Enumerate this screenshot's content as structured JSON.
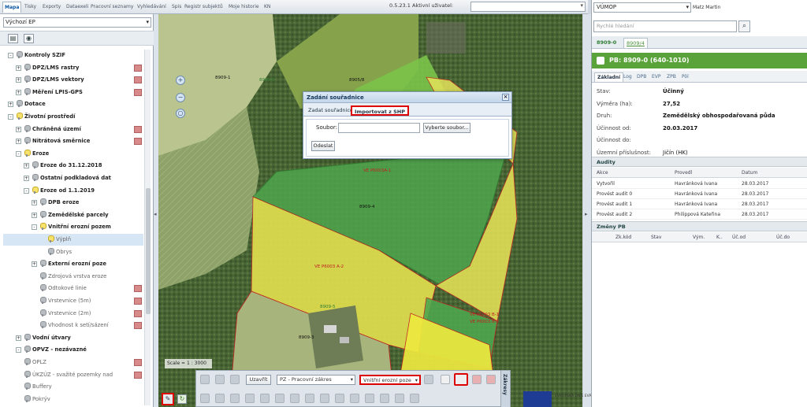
{
  "topbar": {
    "tabs": [
      "Mapa",
      "Tisky",
      "Exporty",
      "Dataexeli",
      "Pracovní seznamy",
      "Vyhledávání",
      "Spis",
      "Registr subjektů",
      "Moje historie",
      "KN"
    ],
    "version": "0.5.23.1",
    "user_label": "Aktivní uživatel:"
  },
  "left": {
    "ep_select": "Výchozí EP",
    "tree": [
      {
        "label": "Kontroly SZIF",
        "bold": true,
        "indent": 0,
        "exp": "-",
        "bulb": false
      },
      {
        "label": "DPZ/LMS rastry",
        "bold": true,
        "indent": 1,
        "exp": "+",
        "bulb": false,
        "legend": true
      },
      {
        "label": "DPZ/LMS vektory",
        "bold": true,
        "indent": 1,
        "exp": "+",
        "bulb": false,
        "legend": true
      },
      {
        "label": "Měření LPIS-GPS",
        "bold": true,
        "indent": 1,
        "exp": "+",
        "bulb": false,
        "legend": true
      },
      {
        "label": "Dotace",
        "bold": true,
        "indent": 0,
        "exp": "+",
        "bulb": false
      },
      {
        "label": "Životní prostředí",
        "bold": true,
        "indent": 0,
        "exp": "-",
        "bulb": true
      },
      {
        "label": "Chráněná území",
        "bold": true,
        "indent": 1,
        "exp": "+",
        "bulb": false,
        "legend": true
      },
      {
        "label": "Nitrátová směrnice",
        "bold": true,
        "indent": 1,
        "exp": "+",
        "bulb": false,
        "legend": true
      },
      {
        "label": "Eroze",
        "bold": true,
        "indent": 1,
        "exp": "-",
        "bulb": true
      },
      {
        "label": "Eroze do 31.12.2018",
        "bold": true,
        "indent": 2,
        "exp": "+",
        "bulb": false
      },
      {
        "label": "Ostatní podkladová dat",
        "bold": true,
        "indent": 2,
        "exp": "+",
        "bulb": false
      },
      {
        "label": "Eroze od 1.1.2019",
        "bold": true,
        "indent": 2,
        "exp": "-",
        "bulb": true
      },
      {
        "label": "DPB eroze",
        "bold": true,
        "indent": 3,
        "exp": "+",
        "bulb": false
      },
      {
        "label": "Zemědělské parcely",
        "bold": true,
        "indent": 3,
        "exp": "+",
        "bulb": false
      },
      {
        "label": "Vnitřní erozní pozem",
        "bold": true,
        "indent": 3,
        "exp": "-",
        "bulb": true
      },
      {
        "label": "Výplň",
        "bold": false,
        "indent": 4,
        "exp": "",
        "bulb": true,
        "selected": true
      },
      {
        "label": "Obrys",
        "bold": false,
        "indent": 4,
        "exp": "",
        "bulb": false
      },
      {
        "label": "Externí erozní poze",
        "bold": true,
        "indent": 3,
        "exp": "+",
        "bulb": false
      },
      {
        "label": "Zdrojová vrstva eroze",
        "bold": false,
        "indent": 3,
        "exp": "",
        "bulb": false
      },
      {
        "label": "Odtokové linie",
        "bold": false,
        "indent": 3,
        "exp": "",
        "bulb": false,
        "legend": true
      },
      {
        "label": "Vrstevnice (5m)",
        "bold": false,
        "indent": 3,
        "exp": "",
        "bulb": false,
        "legend": true
      },
      {
        "label": "Vrstevnice (2m)",
        "bold": false,
        "indent": 3,
        "exp": "",
        "bulb": false,
        "legend": true
      },
      {
        "label": "Vhodnost k setí/sázení",
        "bold": false,
        "indent": 3,
        "exp": "",
        "bulb": false,
        "legend": true
      },
      {
        "label": "Vodní útvary",
        "bold": true,
        "indent": 1,
        "exp": "+",
        "bulb": false
      },
      {
        "label": "OPVZ - nezávazné",
        "bold": true,
        "indent": 1,
        "exp": "-",
        "bulb": false
      },
      {
        "label": "OPLZ",
        "bold": false,
        "indent": 1,
        "exp": "",
        "bulb": false,
        "legend": true
      },
      {
        "label": "ÚKZÚZ - svažité pozemky nad",
        "bold": false,
        "indent": 1,
        "exp": "",
        "bulb": false,
        "legend": true
      },
      {
        "label": "Buffery",
        "bold": false,
        "indent": 1,
        "exp": "",
        "bulb": false
      },
      {
        "label": "Pokrýv",
        "bold": false,
        "indent": 1,
        "exp": "",
        "bulb": false
      }
    ]
  },
  "map": {
    "scale": "Scale = 1 : 3000",
    "labels": [
      {
        "text": "8909-0",
        "color": "#2e7d32"
      },
      {
        "text": "8909-1",
        "color": "#111"
      },
      {
        "text": "8905/8",
        "color": "#111"
      },
      {
        "text": "VE P6003A-1",
        "color": "#c02020"
      },
      {
        "text": "8909-4",
        "color": "#111"
      },
      {
        "text": "VE P6003 A-2",
        "color": "#c02020"
      },
      {
        "text": "8909-5",
        "color": "#2e7d32"
      },
      {
        "text": "VE P6003 B-1",
        "color": "#c02020"
      },
      {
        "text": "VE P6003 B-2",
        "color": "#c02020"
      },
      {
        "text": "8909-3",
        "color": "#111"
      }
    ]
  },
  "dialog": {
    "title": "Zadání souřadnice",
    "tab_coords": "Zadat souřadnice",
    "tab_import": "Importovat z SHP",
    "file_label": "Soubor:",
    "browse": "Vyberte soubor...",
    "submit": "Odeslat"
  },
  "bottombar": {
    "close_btn": "Uzavřít",
    "layer_select": "PZ - Pracovní zákres",
    "erosion_select": "Vnitřní erozní poze",
    "zakresy": "Zákresy",
    "eu_text": "EVROPSKÁ UNIE EVROPSKÝ FOND"
  },
  "right": {
    "org": "VÚMOP",
    "user": "Matz Martin",
    "search_placeholder": "Rychlé hledání",
    "tab_a": "8909-0",
    "tab_b": "8909/4",
    "pb_title": "PB: 8909-0 (640-1010)",
    "detail_tabs": [
      "Základní",
      "Log",
      "DPB",
      "EVP",
      "ZPB",
      "Pöl"
    ],
    "props": [
      {
        "k": "Stav:",
        "v": "Účinný",
        "bold": true
      },
      {
        "k": "Výměra (ha):",
        "v": "27,52",
        "bold": true
      },
      {
        "k": "Druh:",
        "v": "Zemědělský obhospodařovaná půda",
        "bold": true
      },
      {
        "k": "Účinnost od:",
        "v": "20.03.2017",
        "bold": true
      },
      {
        "k": "Účinnost do:",
        "v": "",
        "bold": false
      },
      {
        "k": "Územní příslušnost:",
        "v": "Jičín (HK)",
        "bold": false
      }
    ],
    "audits_title": "Audity",
    "audit_headers": [
      "Akce",
      "Provedl",
      "Datum"
    ],
    "audit_rows": [
      [
        "Vytvořil",
        "Havránková Ivana",
        "28.03.2017"
      ],
      [
        "Provést audit 0",
        "Havránková Ivana",
        "28.03.2017"
      ],
      [
        "Provést audit 1",
        "Havránková Ivana",
        "28.03.2017"
      ],
      [
        "Provést audit 2",
        "Philippová Kateřina",
        "28.03.2017"
      ]
    ],
    "changes_title": "Změny PB",
    "change_headers": [
      "Zk.kód",
      "Stav",
      "Vým.",
      "K..",
      "Úč.od",
      "Úč.do"
    ]
  }
}
